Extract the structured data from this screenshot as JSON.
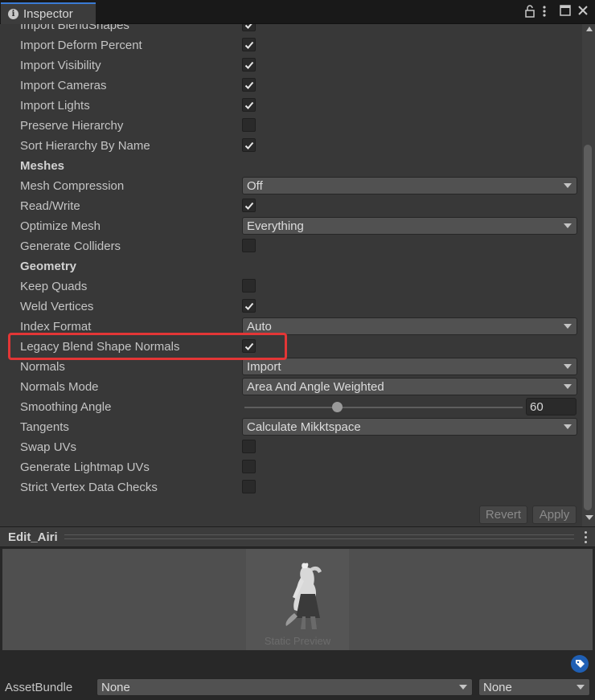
{
  "window": {
    "tab_title": "Inspector",
    "tab_icon": "info-icon",
    "controls": [
      "lock-icon",
      "kebab-icon",
      "maximize-icon",
      "close-icon"
    ]
  },
  "rows": [
    {
      "label": "Import BlendShapes",
      "type": "checkbox",
      "checked": true
    },
    {
      "label": "Import Deform Percent",
      "type": "checkbox",
      "checked": true
    },
    {
      "label": "Import Visibility",
      "type": "checkbox",
      "checked": true
    },
    {
      "label": "Import Cameras",
      "type": "checkbox",
      "checked": true
    },
    {
      "label": "Import Lights",
      "type": "checkbox",
      "checked": true
    },
    {
      "label": "Preserve Hierarchy",
      "type": "checkbox",
      "checked": false
    },
    {
      "label": "Sort Hierarchy By Name",
      "type": "checkbox",
      "checked": true
    },
    {
      "label": "Meshes",
      "type": "header"
    },
    {
      "label": "Mesh Compression",
      "type": "dropdown",
      "value": "Off"
    },
    {
      "label": "Read/Write",
      "type": "checkbox",
      "checked": true
    },
    {
      "label": "Optimize Mesh",
      "type": "dropdown",
      "value": "Everything"
    },
    {
      "label": "Generate Colliders",
      "type": "checkbox",
      "checked": false
    },
    {
      "label": "Geometry",
      "type": "header"
    },
    {
      "label": "Keep Quads",
      "type": "checkbox",
      "checked": false
    },
    {
      "label": "Weld Vertices",
      "type": "checkbox",
      "checked": true
    },
    {
      "label": "Index Format",
      "type": "dropdown",
      "value": "Auto"
    },
    {
      "label": "Legacy Blend Shape Normals",
      "type": "checkbox",
      "checked": true,
      "highlighted": true
    },
    {
      "label": "Normals",
      "type": "dropdown",
      "value": "Import"
    },
    {
      "label": "Normals Mode",
      "type": "dropdown",
      "value": "Area And Angle Weighted"
    },
    {
      "label": "Smoothing Angle",
      "type": "slider",
      "value": "60",
      "min": 0,
      "max": 180
    },
    {
      "label": "Tangents",
      "type": "dropdown",
      "value": "Calculate Mikktspace"
    },
    {
      "label": "Swap UVs",
      "type": "checkbox",
      "checked": false
    },
    {
      "label": "Generate Lightmap UVs",
      "type": "checkbox",
      "checked": false
    },
    {
      "label": "Strict Vertex Data Checks",
      "type": "checkbox",
      "checked": false
    }
  ],
  "buttons": {
    "revert": "Revert",
    "apply": "Apply"
  },
  "preview": {
    "title": "Edit_Airi",
    "static_label": "Static Preview"
  },
  "footer": {
    "assetbundle_label": "AssetBundle",
    "assetbundle_name": "None",
    "assetbundle_variant": "None"
  },
  "colors": {
    "highlight": "#e33636",
    "tab_accent": "#3a7bd5",
    "tag_icon": "#1f5fb4"
  }
}
